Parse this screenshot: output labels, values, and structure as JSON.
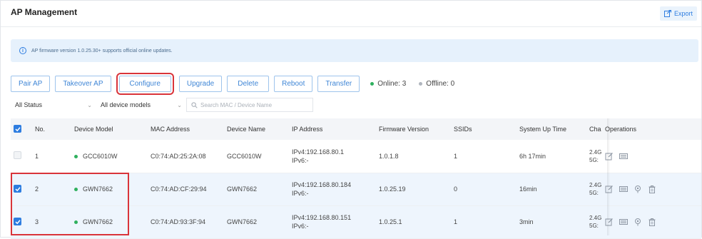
{
  "page": {
    "title": "AP Management",
    "export_label": "Export"
  },
  "notice": {
    "text": "AP firmware version 1.0.25.30+ supports official online updates."
  },
  "toolbar": {
    "buttons": [
      "Pair AP",
      "Takeover AP",
      "Configure",
      "Upgrade",
      "Delete",
      "Reboot",
      "Transfer"
    ],
    "online_label": "Online: 3",
    "offline_label": "Offline: 0",
    "online_color": "#2fb05e",
    "offline_color": "#b0b6be"
  },
  "filters": {
    "status": "All Status",
    "models": "All device models",
    "search_placeholder": "Search MAC / Device Name"
  },
  "table": {
    "columns": [
      "No.",
      "Device Model",
      "MAC Address",
      "Device Name",
      "IP Address",
      "Firmware Version",
      "SSIDs",
      "System Up Time",
      "Cha",
      "Operations"
    ],
    "rows": [
      {
        "no": "1",
        "model": "GCC6010W",
        "mac": "C0:74:AD:25:2A:08",
        "name": "GCC6010W",
        "ipv4": "IPv4:192.168.80.1",
        "ipv6": "IPv6:-",
        "firmware": "1.0.1.8",
        "ssids": "1",
        "uptime": "6h 17min",
        "ch1": "2.4G",
        "ch2": "5G:",
        "checked": false
      },
      {
        "no": "2",
        "model": "GWN7662",
        "mac": "C0:74:AD:CF:29:94",
        "name": "GWN7662",
        "ipv4": "IPv4:192.168.80.184",
        "ipv6": "IPv6:-",
        "firmware": "1.0.25.19",
        "ssids": "0",
        "uptime": "16min",
        "ch1": "2.4G",
        "ch2": "5G:",
        "checked": true
      },
      {
        "no": "3",
        "model": "GWN7662",
        "mac": "C0:74:AD:93:3F:94",
        "name": "GWN7662",
        "ipv4": "IPv4:192.168.80.151",
        "ipv6": "IPv6:-",
        "firmware": "1.0.25.1",
        "ssids": "1",
        "uptime": "3min",
        "ch1": "2.4G",
        "ch2": "5G:",
        "checked": true
      }
    ],
    "operation_icons": [
      "edit-icon",
      "device-config-icon",
      "locate-icon",
      "delete-icon"
    ]
  },
  "colors": {
    "accent": "#2e7de0",
    "highlight": "#d9343a",
    "online": "#2fb05e"
  }
}
